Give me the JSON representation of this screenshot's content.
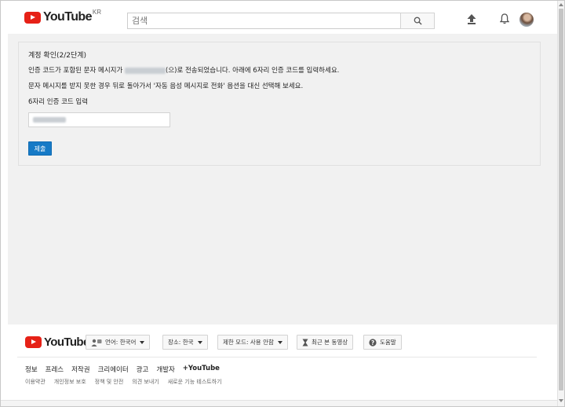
{
  "header": {
    "logo_text": "YouTube",
    "region": "KR",
    "search_placeholder": "검색",
    "icons": [
      "upload-icon",
      "bell-icon",
      "avatar"
    ]
  },
  "verify": {
    "title": "계정 확인(2/2단계)",
    "line1_before": "인증 코드가 포함된 문자 메시지가 ",
    "line1_after": "(으)로 전송되었습니다. 아래에 6자리 인증 코드를 입력하세요.",
    "line2": "문자 메시지를 받지 못한 경우 뒤로 돌아가서 '자동 음성 메시지로 전화' 옵션을 대신 선택해 보세요.",
    "code_label": "6자리 인증 코드 입력",
    "submit_label": "제출"
  },
  "footer": {
    "logo_text": "YouTube",
    "language_label": "언어: 한국어",
    "location_label": "장소: 한국",
    "restricted_label": "제한 모드: 사용 안함",
    "history_label": "최근 본 동영상",
    "help_label": "도움말",
    "links_primary": [
      "정보",
      "프레스",
      "저작권",
      "크리에이터",
      "광고",
      "개발자",
      "+YouTube"
    ],
    "links_secondary": [
      "이용약관",
      "개인정보 보호",
      "정책 및 안전",
      "의견 보내기",
      "새로운 기능 테스트하기"
    ]
  },
  "colors": {
    "brand_red": "#e62117",
    "primary_blue": "#167ac6",
    "page_bg": "#f1f1f1"
  }
}
